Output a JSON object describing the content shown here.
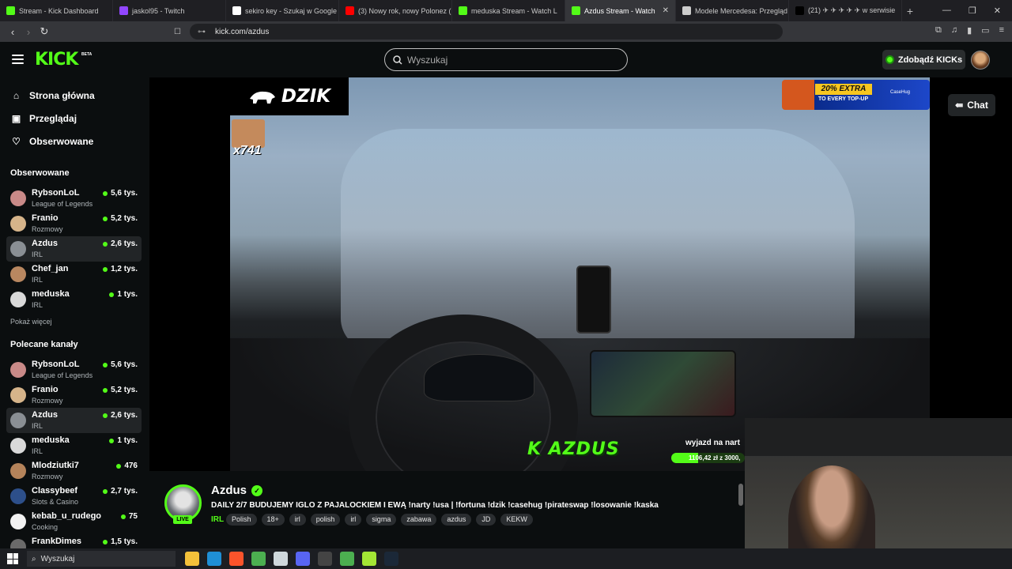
{
  "browser": {
    "tabs": [
      {
        "label": "Stream - Kick Dashboard",
        "icon": "kick-icon",
        "color": "#53fc18"
      },
      {
        "label": "jaskol95 - Twitch",
        "icon": "twitch-icon",
        "color": "#9146ff"
      },
      {
        "label": "sekiro key - Szukaj w Google",
        "icon": "google-icon",
        "color": "#ffffff"
      },
      {
        "label": "(3) Nowy rok, nowy Polonez (m",
        "icon": "youtube-icon",
        "color": "#ff0000"
      },
      {
        "label": "meduska Stream - Watch L",
        "icon": "kick-icon",
        "color": "#53fc18"
      },
      {
        "label": "Azdus Stream - Watch",
        "icon": "kick-icon",
        "color": "#53fc18",
        "active": true
      },
      {
        "label": "Modele Mercedesa: Przegląd m",
        "icon": "mercedes-icon",
        "color": "#cccccc"
      },
      {
        "label": "(21) ✈ ✈ ✈ ✈ ✈ w serwisie",
        "icon": "x-icon",
        "color": "#000000"
      }
    ],
    "url": "kick.com/azdus"
  },
  "header": {
    "logo": "KICK",
    "logo_badge": "BETA",
    "search_placeholder": "Wyszukaj",
    "kicks_button": "Zdobądź KICKs"
  },
  "sidebar": {
    "nav": [
      {
        "label": "Strona główna",
        "icon": "home-icon"
      },
      {
        "label": "Przeglądaj",
        "icon": "browse-icon"
      },
      {
        "label": "Obserwowane",
        "icon": "heart-icon"
      }
    ],
    "followed_title": "Obserwowane",
    "followed": [
      {
        "name": "RybsonLoL",
        "category": "League of Legends",
        "viewers": "5,6 tys.",
        "color": "#c98a88"
      },
      {
        "name": "Franio",
        "category": "Rozmowy",
        "viewers": "5,2 tys.",
        "color": "#d6b48a"
      },
      {
        "name": "Azdus",
        "category": "IRL",
        "viewers": "2,6 tys.",
        "color": "#8a8f94",
        "selected": true
      },
      {
        "name": "Chef_jan",
        "category": "IRL",
        "viewers": "1,2 tys.",
        "color": "#b88760"
      },
      {
        "name": "meduska",
        "category": "IRL",
        "viewers": "1 tys.",
        "color": "#d9d9d9"
      }
    ],
    "show_more": "Pokaż więcej",
    "recommended_title": "Polecane kanały",
    "recommended": [
      {
        "name": "RybsonLoL",
        "category": "League of Legends",
        "viewers": "5,6 tys.",
        "color": "#c98a88"
      },
      {
        "name": "Franio",
        "category": "Rozmowy",
        "viewers": "5,2 tys.",
        "color": "#d6b48a"
      },
      {
        "name": "Azdus",
        "category": "IRL",
        "viewers": "2,6 tys.",
        "color": "#8a8f94",
        "selected": true
      },
      {
        "name": "meduska",
        "category": "IRL",
        "viewers": "1 tys.",
        "color": "#d9d9d9"
      },
      {
        "name": "Mlodziutki7",
        "category": "Rozmowy",
        "viewers": "476",
        "color": "#b5835a"
      },
      {
        "name": "Classybeef",
        "category": "Slots & Casino",
        "viewers": "2,7 tys.",
        "color": "#2d4f8a"
      },
      {
        "name": "kebab_u_rudego",
        "category": "Cooking",
        "viewers": "75",
        "color": "#f2f2f2"
      },
      {
        "name": "FrankDimes",
        "category": "",
        "viewers": "1,5 tys.",
        "color": "#6a6a6a"
      }
    ]
  },
  "player": {
    "overlay_logo": "DZIK",
    "emote_count": "x741",
    "promo_title": "20% EXTRA",
    "promo_sub": "TO EVERY TOP-UP",
    "promo_brand": "CaseHug",
    "streamer_tag": "K AZDUS",
    "goal_label": "wyjazd na nart",
    "goal_progress": "1106,42 zł z 3000,",
    "goal_fraction": 0.37,
    "chat_button": "Chat"
  },
  "stream": {
    "name": "Azdus",
    "live_badge": "LIVE",
    "title": "DAILY 2/7 BUDUJEMY IGLO Z PAJALOCKIEM I EWĄ !narty !usa | !fortuna !dzik !casehug !pirateswap !losowanie !kaska",
    "category": "IRL",
    "tags": [
      "Polish",
      "18+",
      "irl",
      "polish",
      "irl",
      "sigma",
      "zabawa",
      "azdus",
      "JD",
      "KEKW"
    ]
  },
  "taskbar": {
    "search_placeholder": "Wyszukaj",
    "apps": [
      {
        "name": "file-explorer-icon",
        "color": "#f3c13a"
      },
      {
        "name": "edge-icon",
        "color": "#1f8fd6"
      },
      {
        "name": "brave-icon",
        "color": "#fb542b"
      },
      {
        "name": "chrome-icon",
        "color": "#4caf50"
      },
      {
        "name": "app-icon",
        "color": "#cfd8dc"
      },
      {
        "name": "discord-icon",
        "color": "#5865f2"
      },
      {
        "name": "obs-icon",
        "color": "#444444"
      },
      {
        "name": "play-icon",
        "color": "#4caf50"
      },
      {
        "name": "app2-icon",
        "color": "#a3e635"
      },
      {
        "name": "steam-icon",
        "color": "#1b2838"
      }
    ]
  }
}
